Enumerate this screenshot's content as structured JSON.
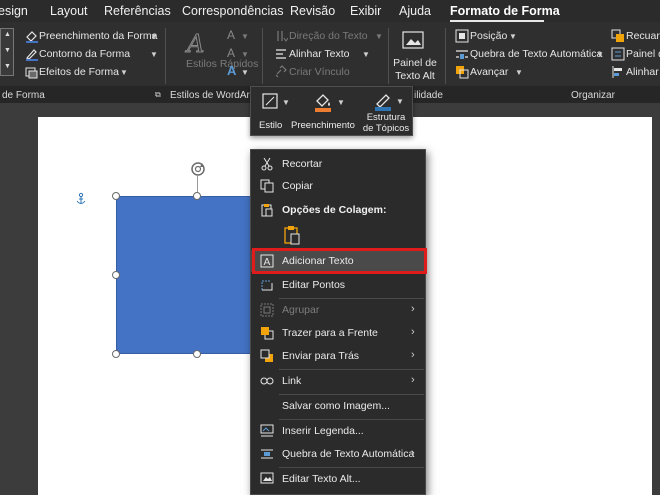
{
  "tabs": [
    {
      "label": "esign",
      "active": false
    },
    {
      "label": "Layout",
      "active": false
    },
    {
      "label": "Referências",
      "active": false
    },
    {
      "label": "Correspondências",
      "active": false
    },
    {
      "label": "Revisão",
      "active": false
    },
    {
      "label": "Exibir",
      "active": false
    },
    {
      "label": "Ajuda",
      "active": false
    },
    {
      "label": "Formato de Forma",
      "active": true
    }
  ],
  "ribbon": {
    "shape_styles": {
      "fill": "Preenchimento da Forma",
      "outline": "Contorno da Forma",
      "effects": "Efeitos de Forma",
      "group_label": "de Forma"
    },
    "wordart": {
      "quick_styles": "Estilos Rápidos",
      "group_label": "Estilos de WordArt"
    },
    "text": {
      "direction": "Direção do Texto",
      "align": "Alinhar Texto",
      "link": "Criar Vínculo"
    },
    "accessibility": {
      "alt_text_pane": "Painel de Texto Alt",
      "group_label": "ilidade"
    },
    "arrange": {
      "position": "Posição",
      "wrap": "Quebra de Texto Automática",
      "bring_forward": "Avançar",
      "send_back": "Recuar",
      "selection_pane": "Painel d",
      "align": "Alinhar",
      "group_label": "Organizar"
    }
  },
  "minibar": {
    "style": "Estilo",
    "fill": "Preenchimento",
    "outline": "Estrutura de Tópicos"
  },
  "context_menu": {
    "cut": "Recortar",
    "copy": "Copiar",
    "paste_options": "Opções de Colagem:",
    "add_text": "Adicionar Texto",
    "edit_points": "Editar Pontos",
    "group": "Agrupar",
    "bring_front": "Trazer para a Frente",
    "send_back": "Enviar para Trás",
    "link": "Link",
    "save_image": "Salvar como Imagem...",
    "insert_caption": "Inserir Legenda...",
    "wrap_text": "Quebra de Texto Automática",
    "edit_alt_text": "Editar Texto Alt..."
  },
  "colors": {
    "shape_fill": "#4472c4",
    "highlight_border": "#e01b1b",
    "ribbon_bg": "#2f2f2f"
  }
}
